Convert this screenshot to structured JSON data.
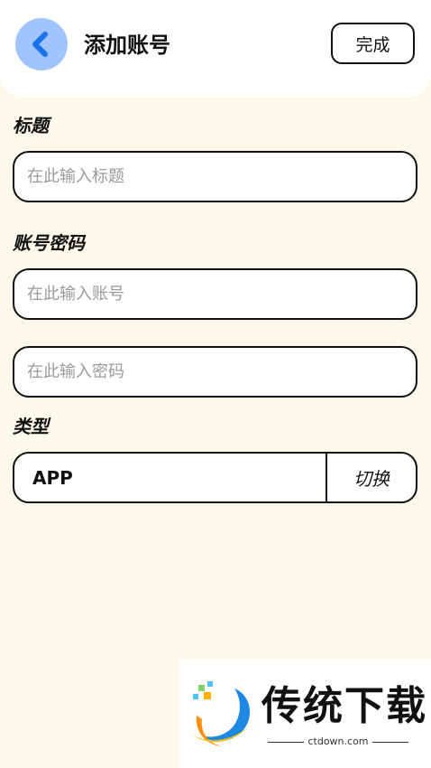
{
  "header": {
    "title": "添加账号",
    "done_label": "完成",
    "back_icon": "chevron-left-icon"
  },
  "sections": {
    "title_label": "标题",
    "account_label": "账号密码",
    "type_label": "类型"
  },
  "inputs": {
    "title_placeholder": "在此输入标题",
    "account_placeholder": "在此输入账号",
    "password_placeholder": "在此输入密码"
  },
  "type": {
    "value": "APP",
    "switch_label": "切换"
  },
  "watermark": {
    "name": "传统下载",
    "url": "ctdown.com"
  },
  "colors": {
    "background": "#fcf8ea",
    "accent": "#1a73e8",
    "back_circle": "#9fc4ff"
  }
}
